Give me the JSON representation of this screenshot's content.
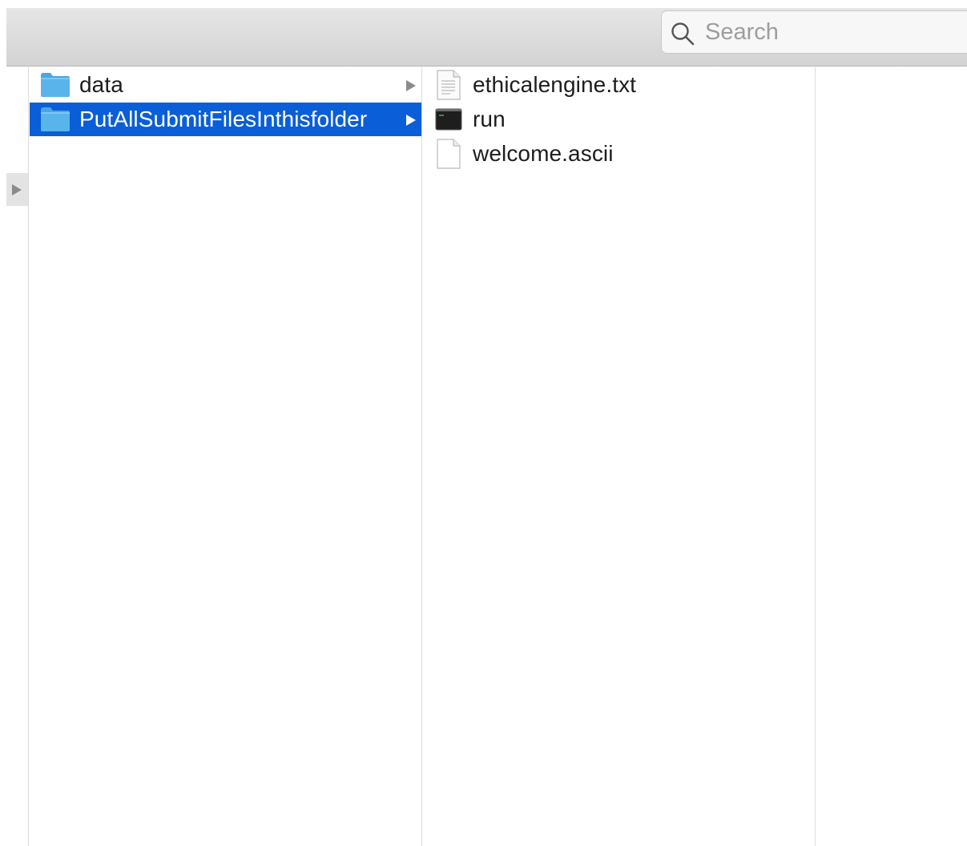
{
  "search": {
    "placeholder": "Search",
    "icon": "magnifier-icon"
  },
  "sidebar": {
    "toggle_icon": "triangle-right-icon"
  },
  "columns": [
    {
      "items": [
        {
          "label": "data",
          "type": "folder",
          "selected": false,
          "icon": "folder-icon"
        },
        {
          "label": "PutAllSubmitFilesInthisfolder",
          "type": "folder",
          "selected": true,
          "icon": "folder-icon"
        }
      ]
    },
    {
      "items": [
        {
          "label": "ethicalengine.txt",
          "type": "text-file",
          "icon": "text-document-icon"
        },
        {
          "label": "run",
          "type": "executable",
          "icon": "terminal-executable-icon"
        },
        {
          "label": "welcome.ascii",
          "type": "file",
          "icon": "blank-document-icon"
        }
      ]
    },
    {
      "items": []
    }
  ],
  "colors": {
    "selection": "#0a5ed7",
    "folder": "#5ab4ec",
    "toolbar": "#d8d8d8"
  }
}
